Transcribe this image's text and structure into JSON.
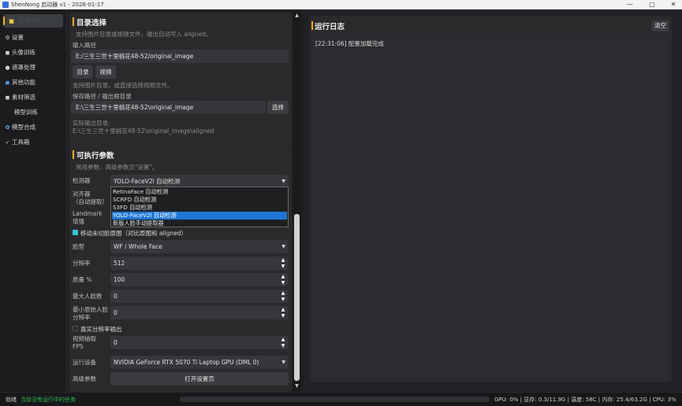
{
  "window": {
    "title": "ShenNong 启动器 v1 - 2026-01-17",
    "minimize": "—",
    "maximize": "□",
    "close": "✕"
  },
  "sidebar": {
    "items": [
      {
        "label": "目录选择",
        "icon": "■"
      },
      {
        "label": "设置",
        "icon": "⚙"
      },
      {
        "label": "头像训练",
        "icon": "◼"
      },
      {
        "label": "遮罩处理",
        "icon": "●"
      },
      {
        "label": "其他功能",
        "icon": "◼"
      },
      {
        "label": "素材筛选",
        "icon": "◼"
      },
      {
        "label": "模型训练",
        "icon": ""
      },
      {
        "label": "模型合成",
        "icon": "✿"
      },
      {
        "label": "工具箱",
        "icon": "✓"
      }
    ]
  },
  "dir_card": {
    "title": "目录选择",
    "desc": "支持图片目录或视频文件，输出自动写入 aligned。",
    "input_label": "输入路径",
    "input_value": "E:/三生三世十里桃花48-52/original_image",
    "btn_dir": "目录",
    "btn_video": "视频",
    "hint": "支持图片目录，或直接选择视频文件。",
    "save_label": "保存路径 / 输出根目录",
    "save_value": "E:\\三生三世十里桃花48-52\\original_image",
    "btn_select": "选择",
    "actual_label": "实际输出目录:",
    "actual_value": "E:\\三生三世十里桃花48-52\\original_image\\aligned"
  },
  "params_card": {
    "title": "可执行参数",
    "desc": "常用参数，高级参数见\"设置\"。",
    "detector_label": "检测器",
    "detector_value": "YOLO-FaceV2l 自动检测",
    "detector_options": [
      "RetinaFace 自动检测",
      "SCRFD 自动检测",
      "S3FD 自动检测",
      "YOLO-FaceV2l 自动检测",
      "新版人脸手动提取器"
    ],
    "detector_selected_index": 3,
    "aligner_label": "对齐器\n（自动提取）",
    "landmark_label": "Landmark\n增强",
    "move_chk": "移动未切脸原图（对比原图和 aligned）",
    "face_type_label": "脸型",
    "face_type_value": "WF / Whole Face",
    "res_label": "分辨率",
    "res_value": "512",
    "quality_label": "质量 %",
    "quality_value": "100",
    "max_faces_label": "最大人脸数",
    "max_faces_value": "0",
    "min_res_label": "最小原始人脸\n分辨率",
    "min_res_value": "0",
    "real_res_chk": "真实分辨率输出",
    "fps_label": "视频抽取\nFPS",
    "fps_value": "0",
    "device_label": "运行设备",
    "device_value": "NVIDIA GeForce RTX 5070 Ti Laptop GPU (DML 0)",
    "adv_label": "高级参数",
    "adv_btn": "打开设置页"
  },
  "log": {
    "title": "运行日志",
    "clear_btn": "清空",
    "lines": [
      "[22:31:06] 配置加载完成"
    ]
  },
  "status": {
    "left": "就绪",
    "task": "当前没有运行中的任务",
    "progress": 0,
    "sys": "GPU: 0% | 显存: 0.3/11.9G | 温度: 58C | 内存: 25.4/63.2G | CPU: 3%"
  },
  "colors": {
    "accent": "#ffb21c",
    "selection": "#1e77d4",
    "status_task": "#2fbf4f",
    "checkbox_on": "#33c2d0"
  }
}
